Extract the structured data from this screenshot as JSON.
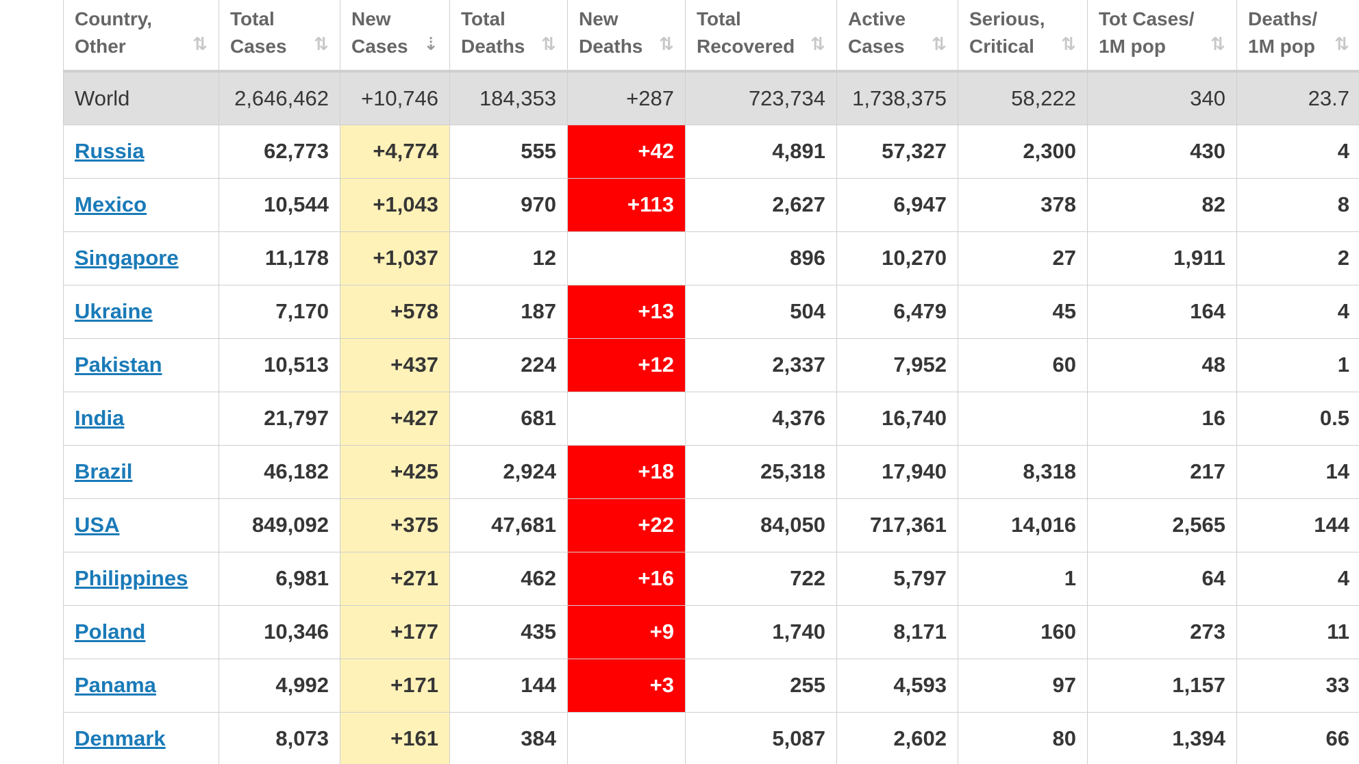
{
  "headers": [
    {
      "line1": "Country,",
      "line2": "Other",
      "sort": "⇅"
    },
    {
      "line1": "Total",
      "line2": "Cases",
      "sort": "⇅"
    },
    {
      "line1": "New",
      "line2": "Cases",
      "sort": "⇣"
    },
    {
      "line1": "Total",
      "line2": "Deaths",
      "sort": "⇅"
    },
    {
      "line1": "New",
      "line2": "Deaths",
      "sort": "⇅"
    },
    {
      "line1": "Total",
      "line2": "Recovered",
      "sort": "⇅"
    },
    {
      "line1": "Active",
      "line2": "Cases",
      "sort": "⇅"
    },
    {
      "line1": "Serious,",
      "line2": "Critical",
      "sort": "⇅"
    },
    {
      "line1": "Tot Cases/",
      "line2": "1M pop",
      "sort": "⇅"
    },
    {
      "line1": "Deaths/",
      "line2": "1M pop",
      "sort": "⇅"
    }
  ],
  "world": {
    "country": "World",
    "total_cases": "2,646,462",
    "new_cases": "+10,746",
    "total_deaths": "184,353",
    "new_deaths": "+287",
    "total_recovered": "723,734",
    "active_cases": "1,738,375",
    "serious_critical": "58,222",
    "cases_per_1m": "340",
    "deaths_per_1m": "23.7"
  },
  "rows": [
    {
      "country": "Russia",
      "total_cases": "62,773",
      "new_cases": "+4,774",
      "total_deaths": "555",
      "new_deaths": "+42",
      "total_recovered": "4,891",
      "active_cases": "57,327",
      "serious_critical": "2,300",
      "cases_per_1m": "430",
      "deaths_per_1m": "4"
    },
    {
      "country": "Mexico",
      "total_cases": "10,544",
      "new_cases": "+1,043",
      "total_deaths": "970",
      "new_deaths": "+113",
      "total_recovered": "2,627",
      "active_cases": "6,947",
      "serious_critical": "378",
      "cases_per_1m": "82",
      "deaths_per_1m": "8"
    },
    {
      "country": "Singapore",
      "total_cases": "11,178",
      "new_cases": "+1,037",
      "total_deaths": "12",
      "new_deaths": "",
      "total_recovered": "896",
      "active_cases": "10,270",
      "serious_critical": "27",
      "cases_per_1m": "1,911",
      "deaths_per_1m": "2"
    },
    {
      "country": "Ukraine",
      "total_cases": "7,170",
      "new_cases": "+578",
      "total_deaths": "187",
      "new_deaths": "+13",
      "total_recovered": "504",
      "active_cases": "6,479",
      "serious_critical": "45",
      "cases_per_1m": "164",
      "deaths_per_1m": "4"
    },
    {
      "country": "Pakistan",
      "total_cases": "10,513",
      "new_cases": "+437",
      "total_deaths": "224",
      "new_deaths": "+12",
      "total_recovered": "2,337",
      "active_cases": "7,952",
      "serious_critical": "60",
      "cases_per_1m": "48",
      "deaths_per_1m": "1"
    },
    {
      "country": "India",
      "total_cases": "21,797",
      "new_cases": "+427",
      "total_deaths": "681",
      "new_deaths": "",
      "total_recovered": "4,376",
      "active_cases": "16,740",
      "serious_critical": "",
      "cases_per_1m": "16",
      "deaths_per_1m": "0.5"
    },
    {
      "country": "Brazil",
      "total_cases": "46,182",
      "new_cases": "+425",
      "total_deaths": "2,924",
      "new_deaths": "+18",
      "total_recovered": "25,318",
      "active_cases": "17,940",
      "serious_critical": "8,318",
      "cases_per_1m": "217",
      "deaths_per_1m": "14"
    },
    {
      "country": "USA",
      "total_cases": "849,092",
      "new_cases": "+375",
      "total_deaths": "47,681",
      "new_deaths": "+22",
      "total_recovered": "84,050",
      "active_cases": "717,361",
      "serious_critical": "14,016",
      "cases_per_1m": "2,565",
      "deaths_per_1m": "144"
    },
    {
      "country": "Philippines",
      "total_cases": "6,981",
      "new_cases": "+271",
      "total_deaths": "462",
      "new_deaths": "+16",
      "total_recovered": "722",
      "active_cases": "5,797",
      "serious_critical": "1",
      "cases_per_1m": "64",
      "deaths_per_1m": "4"
    },
    {
      "country": "Poland",
      "total_cases": "10,346",
      "new_cases": "+177",
      "total_deaths": "435",
      "new_deaths": "+9",
      "total_recovered": "1,740",
      "active_cases": "8,171",
      "serious_critical": "160",
      "cases_per_1m": "273",
      "deaths_per_1m": "11"
    },
    {
      "country": "Panama",
      "total_cases": "4,992",
      "new_cases": "+171",
      "total_deaths": "144",
      "new_deaths": "+3",
      "total_recovered": "255",
      "active_cases": "4,593",
      "serious_critical": "97",
      "cases_per_1m": "1,157",
      "deaths_per_1m": "33"
    },
    {
      "country": "Denmark",
      "total_cases": "8,073",
      "new_cases": "+161",
      "total_deaths": "384",
      "new_deaths": "",
      "total_recovered": "5,087",
      "active_cases": "2,602",
      "serious_critical": "80",
      "cases_per_1m": "1,394",
      "deaths_per_1m": "66"
    }
  ],
  "colors": {
    "link": "#1a7ab8",
    "new_cases_highlight": "#fff2b8",
    "new_deaths_alert": "#ff0000",
    "world_row": "#dfdfdf"
  }
}
